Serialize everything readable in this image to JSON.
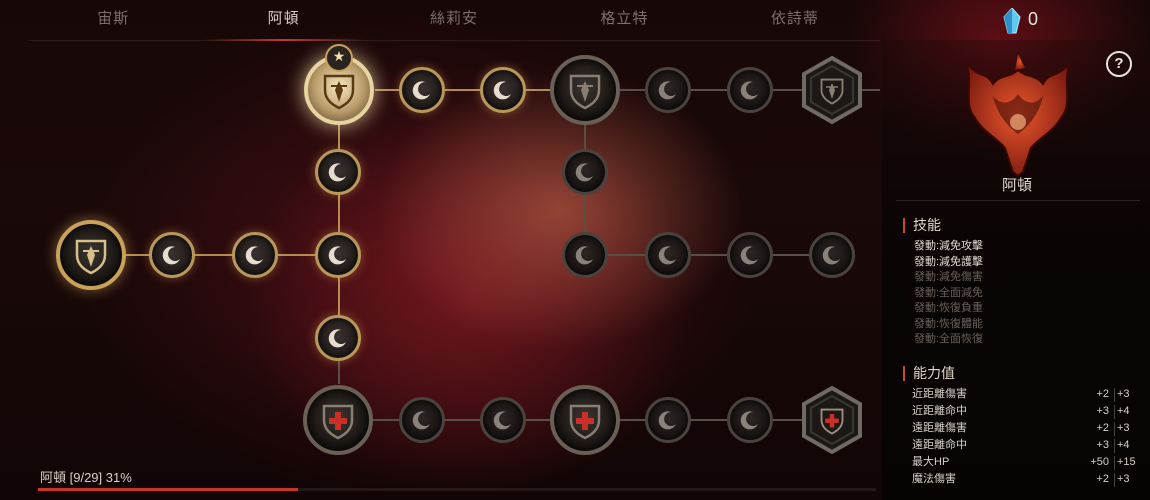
{
  "tabs": [
    {
      "label": "宙斯",
      "active": false
    },
    {
      "label": "阿頓",
      "active": true
    },
    {
      "label": "絲莉安",
      "active": false
    },
    {
      "label": "格立特",
      "active": false
    },
    {
      "label": "依詩蒂",
      "active": false
    }
  ],
  "currency": {
    "icon": "crystal-icon",
    "count": "0"
  },
  "help": {
    "icon": "help-icon",
    "label": "?"
  },
  "hero": {
    "name": "阿頓"
  },
  "skills": {
    "title": "技能",
    "items": [
      {
        "label": "發動:減免攻擊",
        "active": true
      },
      {
        "label": "發動:減免護擊",
        "active": true
      },
      {
        "label": "發動:減免傷害",
        "active": false
      },
      {
        "label": "發動:全面減免",
        "active": false
      },
      {
        "label": "發動:恢復負重",
        "active": false
      },
      {
        "label": "發動:恢復體能",
        "active": false
      },
      {
        "label": "發動:全面恢復",
        "active": false
      }
    ]
  },
  "stats": {
    "title": "能力值",
    "rows": [
      {
        "label": "近距離傷害",
        "v1": "+2",
        "v2": "+3"
      },
      {
        "label": "近距離命中",
        "v1": "+3",
        "v2": "+4"
      },
      {
        "label": "遠距離傷害",
        "v1": "+2",
        "v2": "+3"
      },
      {
        "label": "遠距離命中",
        "v1": "+3",
        "v2": "+4"
      },
      {
        "label": "最大HP",
        "v1": "+50",
        "v2": "+15"
      },
      {
        "label": "魔法傷害",
        "v1": "+2",
        "v2": "+3"
      }
    ]
  },
  "progress": {
    "label": "阿頓 [9/29] 31%",
    "percent": 31
  },
  "colors": {
    "accent": "#c7362a",
    "gold": "#c9a25a"
  }
}
